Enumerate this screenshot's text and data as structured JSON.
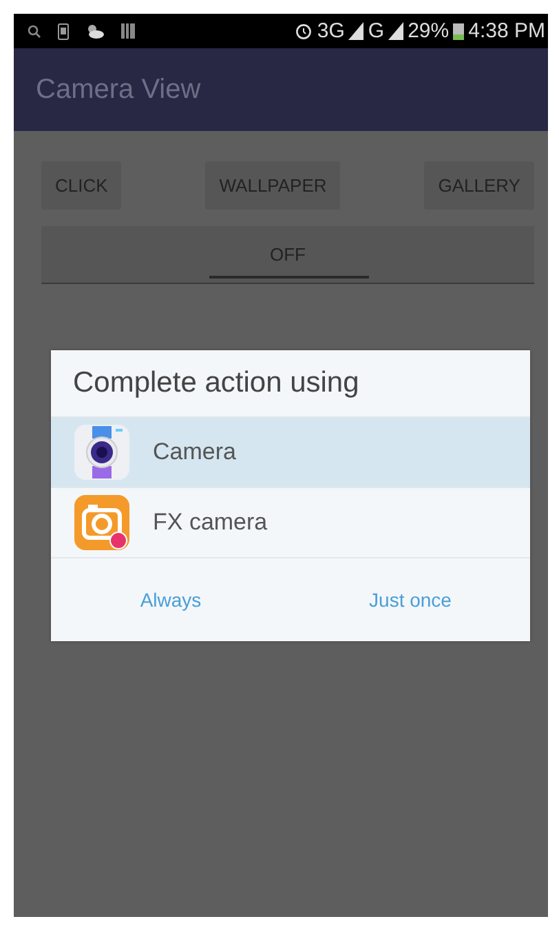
{
  "status_bar": {
    "network": "3G",
    "network_2": "G",
    "battery": "29%",
    "time": "4:38 PM"
  },
  "app_bar": {
    "title": "Camera View"
  },
  "buttons": [
    {
      "label": "CLICK"
    },
    {
      "label": "WALLPAPER"
    },
    {
      "label": "GALLERY"
    }
  ],
  "toggle": {
    "label": "OFF",
    "on": false
  },
  "dialog": {
    "title": "Complete action using",
    "apps": [
      {
        "name": "Camera",
        "kind": "camera",
        "selected": true
      },
      {
        "name": "FX camera",
        "kind": "fx",
        "selected": false
      }
    ],
    "actions": [
      "Always",
      "Just once"
    ]
  }
}
